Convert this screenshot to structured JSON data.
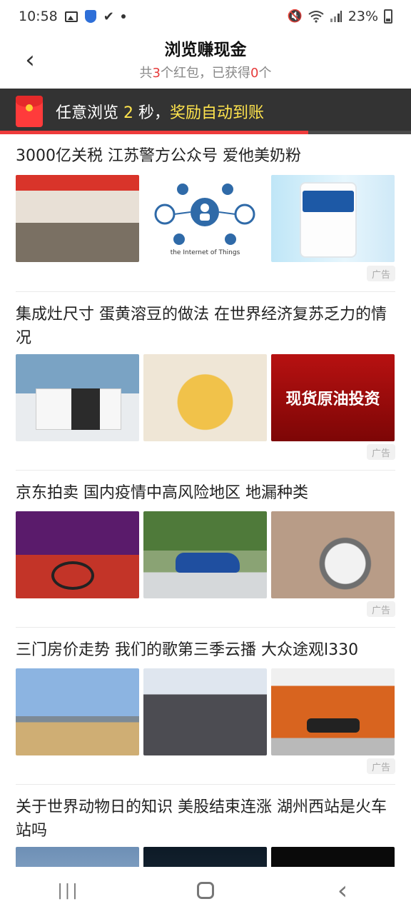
{
  "status_bar": {
    "time": "10:58",
    "battery": "23%"
  },
  "header": {
    "back_glyph": "‹",
    "title": "浏览赚现金",
    "subtitle_prefix": "共",
    "red_count": "3",
    "subtitle_mid": "个红包，已获得",
    "got_count": "0",
    "subtitle_suffix": "个"
  },
  "banner": {
    "text_prefix": "任意浏览 ",
    "seconds": "2",
    "text_mid": " 秒，",
    "text_highlight": "奖励自动到账",
    "progress": 0.75
  },
  "feed": [
    {
      "title": "3000亿关税 江苏警方公众号 爱他美奶粉",
      "ad_label": "广告",
      "images": [
        "meeting-photo",
        "internet-of-things-diagram",
        "aptamil-formula-can"
      ],
      "image_caption": "the Internet of Things"
    },
    {
      "title": "集成灶尺寸 蛋黄溶豆的做法 在世界经济复苏乏力的情况",
      "ad_label": "广告",
      "images": [
        "integrated-stove-kitchen",
        "egg-yolk-beans",
        "crude-oil-ad"
      ],
      "oil_text": "现货原油投资"
    },
    {
      "title": "京东拍卖 国内疫情中高风险地区 地漏种类",
      "ad_label": "广告",
      "images": [
        "bike-promo-store",
        "blue-suv-forest",
        "floor-drain"
      ]
    },
    {
      "title": "三门房价走势 我们的歌第三季云播 大众途观l330",
      "ad_label": "广告",
      "images": [
        "beach-landscape",
        "classroom-lecture",
        "orange-suv"
      ]
    },
    {
      "title": "关于世界动物日的知识 美股结束连涨 湖州西站是火车站吗",
      "images": [
        "glass-building",
        "dark-tech-scene",
        "black-image"
      ]
    }
  ],
  "nav_bar": {
    "recents_glyph": "|||",
    "back_glyph": "‹"
  }
}
